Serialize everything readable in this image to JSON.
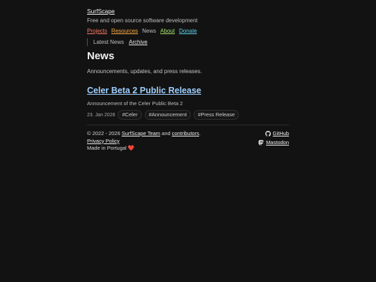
{
  "site": {
    "title": "SurfScape",
    "tagline": "Free and open source software development"
  },
  "nav": {
    "items": [
      {
        "label": "Projects",
        "color": "#ff7a66"
      },
      {
        "label": "Resources",
        "color": "#ffab40"
      },
      {
        "label": "News",
        "color": "#bdbdbd"
      },
      {
        "label": "About",
        "color": "#a5e36b"
      },
      {
        "label": "Donate",
        "color": "#5fd3e6"
      }
    ]
  },
  "subnav": {
    "latest": "Latest News",
    "archive": "Archive"
  },
  "main": {
    "title": "News",
    "description": "Announcements, updates, and press releases."
  },
  "post": {
    "title": "Celer Beta 2 Public Release",
    "summary": "Announcement of the Celer Public Beta 2",
    "date": "23. Jan 2026",
    "tags": [
      "#Celer",
      "#Announcement",
      "#Press Release"
    ]
  },
  "footer": {
    "copyright_prefix": "© 2022 - 2026",
    "team": "SurfScape Team",
    "and": "and",
    "contributors": "contributors",
    "period": ".",
    "privacy": "Privacy Policy",
    "made_in": "Made in Portugal",
    "heart": "❤️",
    "github": "GitHub",
    "mastodon": "Mastodon",
    "github_icon": "github-icon",
    "mastodon_icon": "mastodon-icon"
  }
}
